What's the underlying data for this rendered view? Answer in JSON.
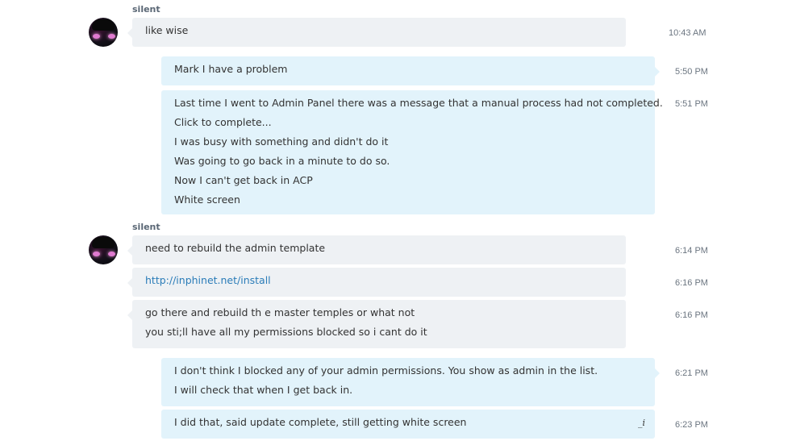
{
  "conversation": {
    "groups": [
      {
        "sender": "silent",
        "direction": "incoming",
        "messages": [
          {
            "lines": [
              "like wise"
            ],
            "time": "10:43 AM"
          }
        ]
      },
      {
        "direction": "outgoing",
        "messages": [
          {
            "lines": [
              "Mark I have a problem"
            ],
            "time": "5:50 PM"
          },
          {
            "lines": [
              "Last time I went to Admin Panel there was a message that a manual process had not completed.",
              "Click to complete...",
              "I was busy with something and didn't do it",
              "Was going to go back in a minute to do so.",
              "Now I can't get back in ACP",
              "White screen"
            ],
            "time": "5:51 PM"
          }
        ]
      },
      {
        "sender": "silent",
        "direction": "incoming",
        "messages": [
          {
            "lines": [
              "need to rebuild the admin template"
            ],
            "time": "6:14 PM"
          },
          {
            "link": "http://inphinet.net/install",
            "time": "6:16 PM"
          },
          {
            "lines": [
              "go there and rebuild th e master temples or what not",
              "you sti;ll have all my permissions blocked so i cant do it"
            ],
            "time": "6:16 PM"
          }
        ]
      },
      {
        "direction": "outgoing",
        "messages": [
          {
            "lines": [
              "I don't think I blocked any of your admin permissions.  You show as admin in the list.",
              "I will check that when I get back in."
            ],
            "time": "6:21 PM"
          },
          {
            "lines": [
              "I did that, said update complete, still getting white screen"
            ],
            "time": "6:23 PM",
            "edited_icon": "edit-pencil-icon"
          }
        ]
      }
    ]
  },
  "colors": {
    "incoming_bubble": "#eef1f4",
    "outgoing_bubble": "#e2f3fb",
    "link": "#2a7cb8"
  }
}
